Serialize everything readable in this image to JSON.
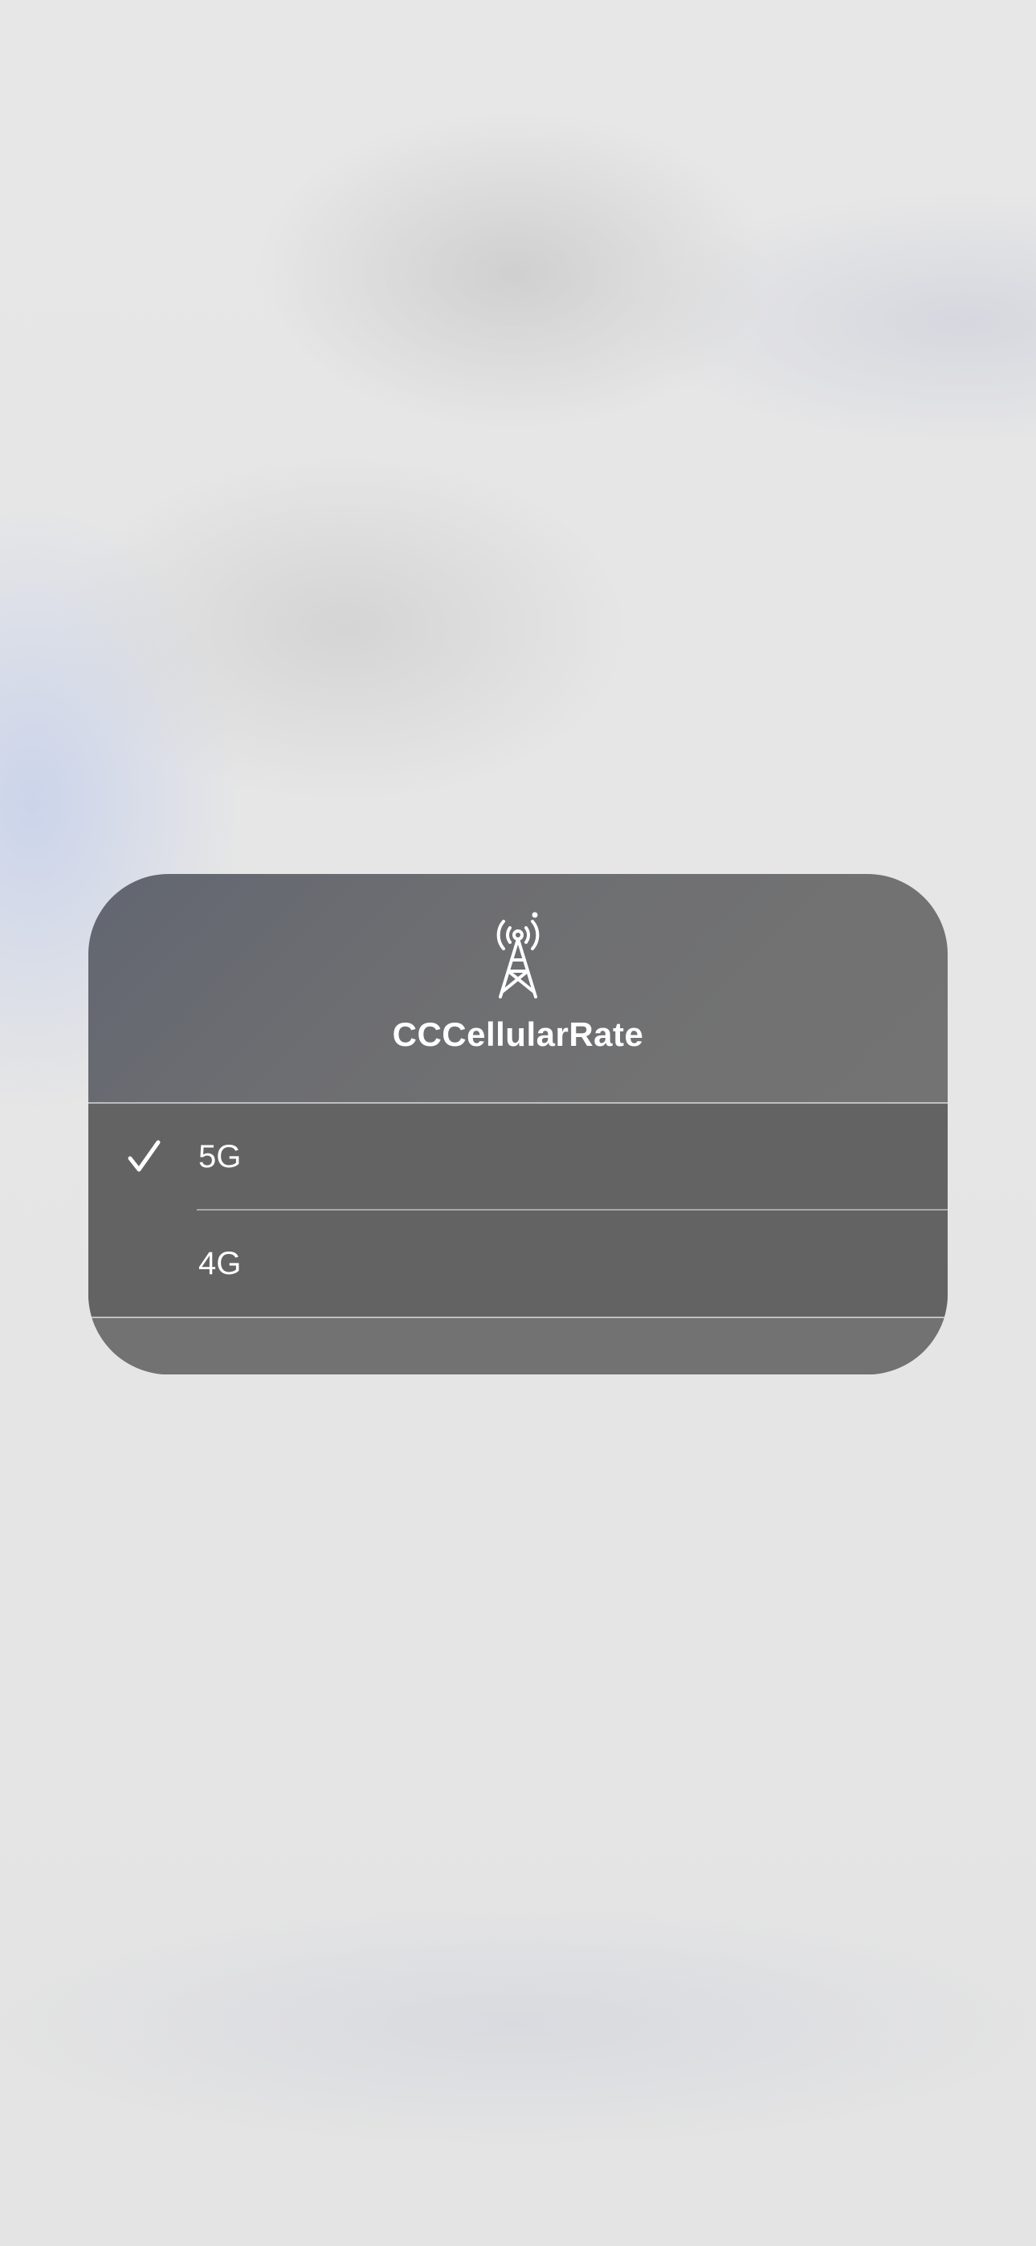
{
  "menu": {
    "icon": "cell-tower-icon",
    "title": "CCCellularRate",
    "options": [
      {
        "label": "5G",
        "selected": true,
        "check_icon": "checkmark-icon"
      },
      {
        "label": "4G",
        "selected": false
      }
    ]
  },
  "colors": {
    "panel": "#6f6f6f",
    "options_background": "#636363",
    "text": "#ffffff",
    "backdrop": "#e6e6e6"
  }
}
